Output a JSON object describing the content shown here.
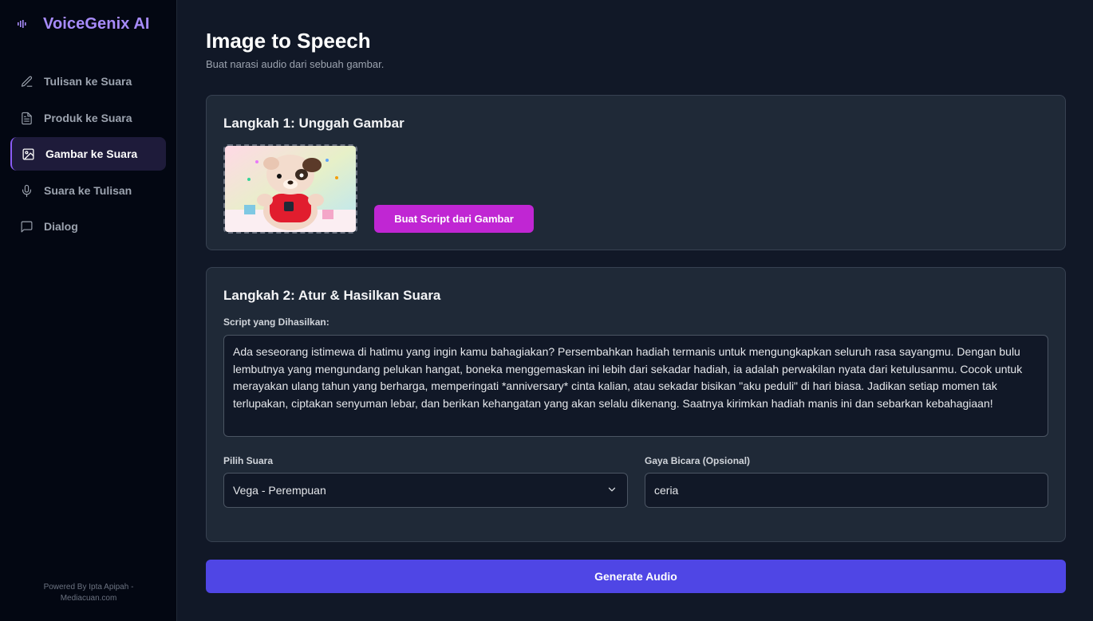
{
  "app": {
    "title": "VoiceGenix AI"
  },
  "sidebar": {
    "items": [
      {
        "label": "Tulisan ke Suara",
        "icon": "pencil-icon"
      },
      {
        "label": "Produk ke Suara",
        "icon": "document-icon"
      },
      {
        "label": "Gambar ke Suara",
        "icon": "image-icon",
        "active": true
      },
      {
        "label": "Suara ke Tulisan",
        "icon": "microphone-icon"
      },
      {
        "label": "Dialog",
        "icon": "chat-bubble-icon"
      }
    ],
    "footer_line1": "Powered By Ipta Apipah -",
    "footer_line2": "Mediacuan.com"
  },
  "page": {
    "title": "Image to Speech",
    "subtitle": "Buat narasi audio dari sebuah gambar."
  },
  "step1": {
    "title": "Langkah 1: Unggah Gambar",
    "button_label": "Buat Script dari Gambar"
  },
  "step2": {
    "title": "Langkah 2: Atur & Hasilkan Suara",
    "script_label": "Script yang Dihasilkan:",
    "script_text": "Ada seseorang istimewa di hatimu yang ingin kamu bahagiakan? Persembahkan hadiah termanis untuk mengungkapkan seluruh rasa sayangmu. Dengan bulu lembutnya yang mengundang pelukan hangat, boneka menggemaskan ini lebih dari sekadar hadiah, ia adalah perwakilan nyata dari ketulusanmu. Cocok untuk merayakan ulang tahun yang berharga, memperingati *anniversary* cinta kalian, atau sekadar bisikan \"aku peduli\" di hari biasa. Jadikan setiap momen tak terlupakan, ciptakan senyuman lebar, dan berikan kehangatan yang akan selalu dikenang. Saatnya kirimkan hadiah manis ini dan sebarkan kebahagiaan!",
    "voice_label": "Pilih Suara",
    "voice_value": "Vega - Perempuan",
    "style_label": "Gaya Bicara (Opsional)",
    "style_value": "ceria"
  },
  "generate": {
    "label": "Generate Audio"
  },
  "colors": {
    "accent": "#a78bfa",
    "script_button": "#c026d3",
    "generate_button": "#4f46e5"
  }
}
